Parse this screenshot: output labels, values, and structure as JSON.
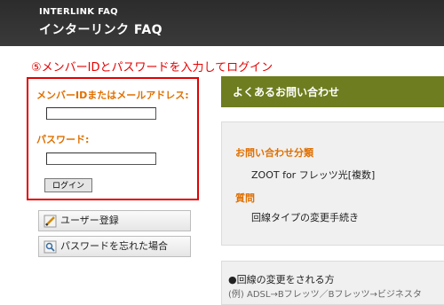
{
  "header": {
    "brand_top": "INTERLINK FAQ",
    "brand_main": "インターリンク FAQ"
  },
  "annotation": "⑤メンバーIDとパスワードを入力してログイン",
  "login": {
    "id_label": "メンバーIDまたはメールアドレス:",
    "password_label": "パスワード:",
    "id_value": "",
    "password_value": "",
    "button_label": "ログイン"
  },
  "side_buttons": {
    "register": "ユーザー登録",
    "forgot": "パスワードを忘れた場合"
  },
  "faq": {
    "panel_title": "よくあるお問い合わせ",
    "category_heading": "お問い合わせ分類",
    "category_value": "ZOOT for フレッツ光[複数]",
    "question_heading": "質問",
    "question_value": "回線タイプの変更手続き",
    "answer_line1": "●回線の変更をされる方",
    "answer_line2": "(例) ADSL→Bフレッツ／Bフレッツ→ビジネスタ"
  },
  "colors": {
    "accent_red": "#e00000",
    "label_orange": "#e07000",
    "panel_olive": "#6e7d1f",
    "header_dark": "#333333"
  }
}
